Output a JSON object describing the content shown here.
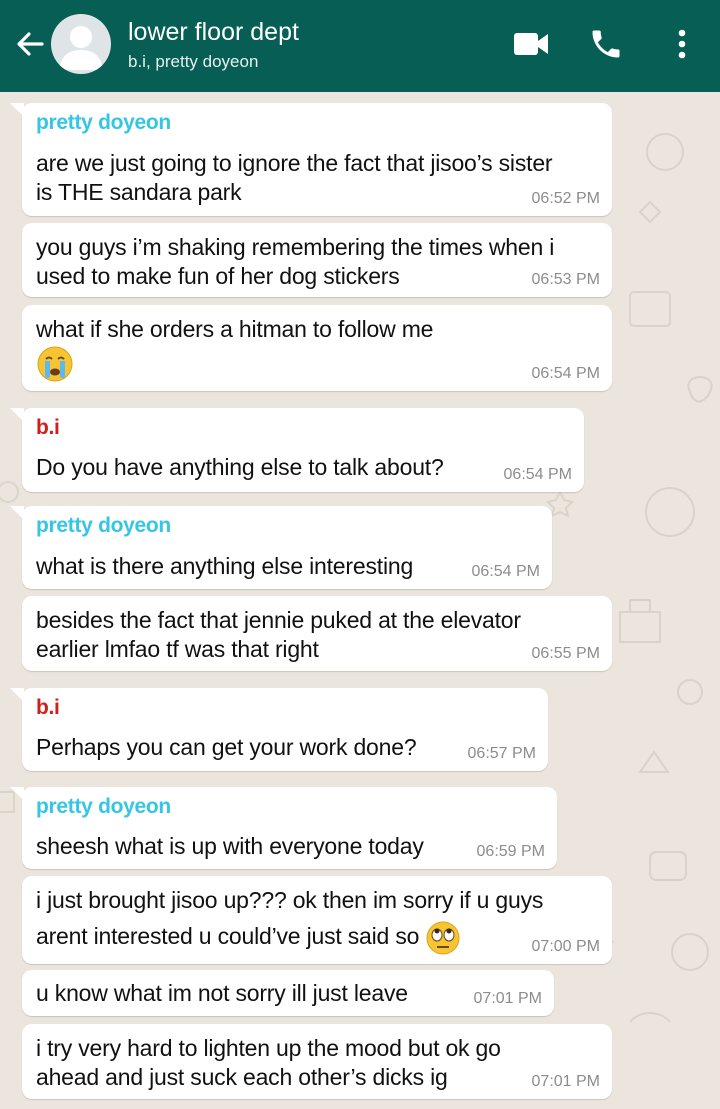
{
  "header": {
    "title": "lower floor dept",
    "subtitle": "b.i, pretty doyeon",
    "icons": [
      "back-arrow-icon",
      "avatar",
      "video-call-icon",
      "phone-icon",
      "more-vert-icon"
    ],
    "color": "#075e54"
  },
  "colors": {
    "doyeon": "#35c6e6",
    "bi": "#d0201c",
    "bubble": "#ffffff",
    "background": "#ece5dd"
  },
  "messages": [
    {
      "sender": "pretty doyeon",
      "lines": [
        "are we just going to ignore the fact that jisoo’s sister",
        "is THE sandara park"
      ],
      "time": "06:52 PM"
    },
    {
      "lines": [
        "you guys i’m shaking remembering the times when i",
        "used to make fun of her dog stickers"
      ],
      "time": "06:53 PM"
    },
    {
      "lines": [
        "what if she orders a hitman to follow me"
      ],
      "emoji": "crying-face-emoji",
      "time": "06:54 PM"
    },
    {
      "sender": "b.i",
      "lines": [
        "Do you have anything else to talk about?"
      ],
      "time": "06:54 PM"
    },
    {
      "sender": "pretty doyeon",
      "lines": [
        "what is there anything else interesting"
      ],
      "time": "06:54 PM"
    },
    {
      "lines": [
        "besides the fact that jennie puked at the elevator",
        "earlier lmfao tf was that right"
      ],
      "time": "06:55 PM"
    },
    {
      "sender": "b.i",
      "lines": [
        "Perhaps you can get your work done?"
      ],
      "time": "06:57 PM"
    },
    {
      "sender": "pretty doyeon",
      "lines": [
        "sheesh what is up with everyone today"
      ],
      "time": "06:59 PM"
    },
    {
      "lines": [
        "i just brought jisoo up??? ok then im sorry if u guys",
        "arent interested u could’ve just said so"
      ],
      "emoji": "eye-roll-emoji",
      "time": "07:00 PM"
    },
    {
      "lines": [
        "u know what im not sorry ill just leave"
      ],
      "time": "07:01 PM"
    },
    {
      "lines": [
        "i try very hard to lighten up the mood but ok go",
        "ahead and just suck each other’s dicks ig"
      ],
      "time": "07:01 PM"
    }
  ]
}
